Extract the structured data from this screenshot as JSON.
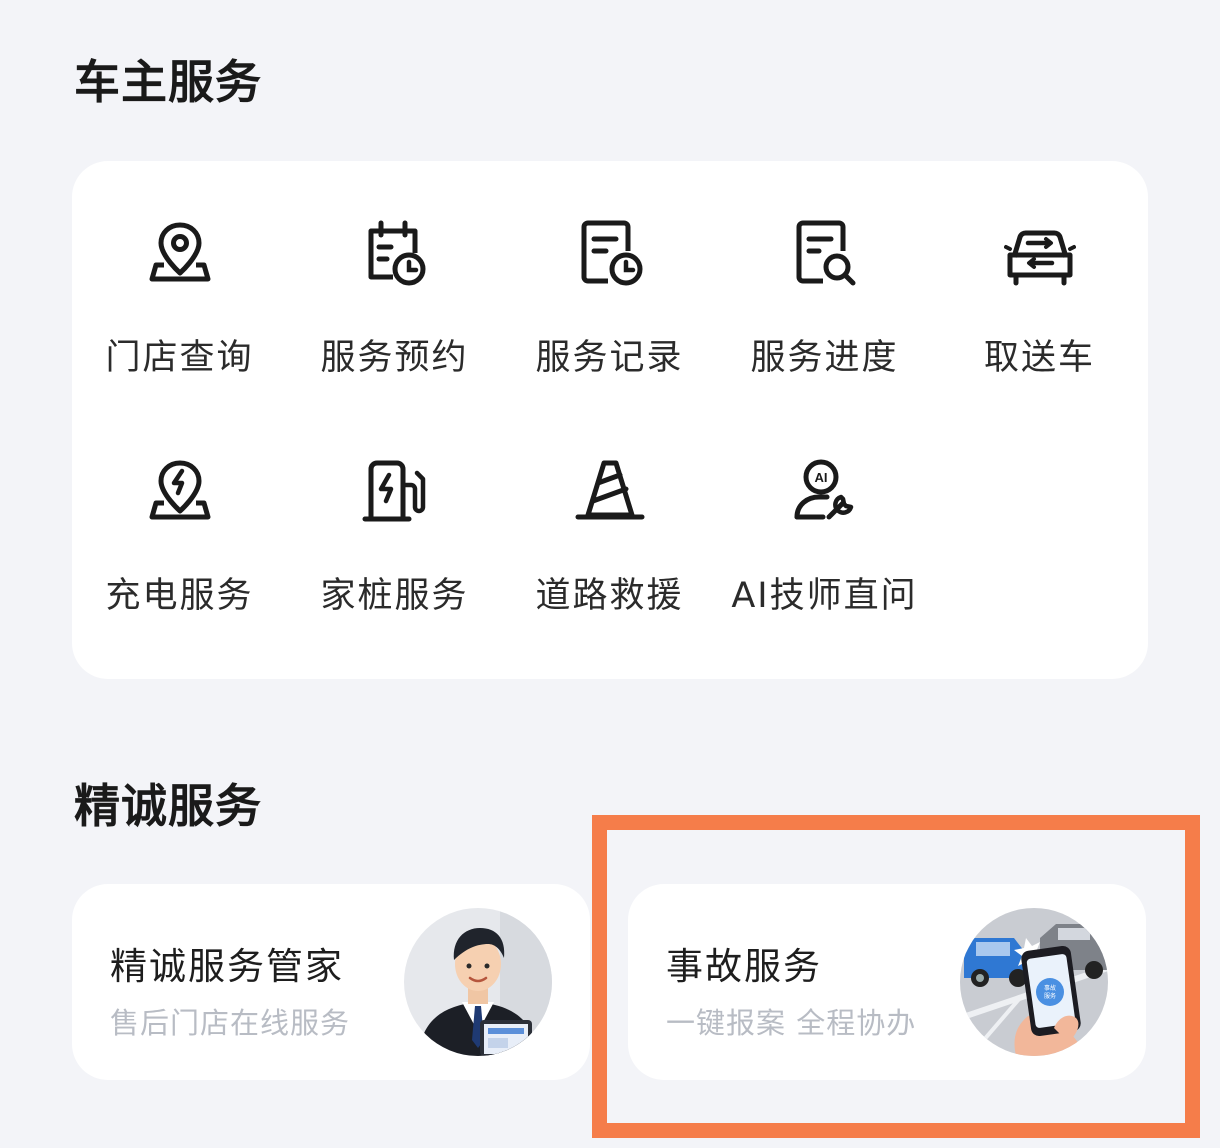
{
  "sections": {
    "owner_services_title": "车主服务",
    "premium_services_title": "精诚服务"
  },
  "grid": [
    {
      "label": "门店查询",
      "icon": "store-location-pin-icon"
    },
    {
      "label": "服务预约",
      "icon": "calendar-clock-icon"
    },
    {
      "label": "服务记录",
      "icon": "document-clock-icon"
    },
    {
      "label": "服务进度",
      "icon": "document-search-icon"
    },
    {
      "label": "取送车",
      "icon": "car-swap-icon"
    },
    {
      "label": "充电服务",
      "icon": "charging-location-pin-icon"
    },
    {
      "label": "家桩服务",
      "icon": "home-charger-icon"
    },
    {
      "label": "道路救援",
      "icon": "traffic-cone-icon"
    },
    {
      "label": "AI技师直问",
      "icon": "ai-technician-icon"
    }
  ],
  "cards": {
    "steward": {
      "title": "精诚服务管家",
      "subtitle": "售后门店在线服务",
      "image": "service-steward-avatar"
    },
    "accident": {
      "title": "事故服务",
      "subtitle": "一键报案 全程协办",
      "image": "car-accident-phone-illustration",
      "phone_screen_text": "事故服务"
    }
  },
  "colors": {
    "background": "#f3f4f8",
    "card": "#ffffff",
    "highlight": "#f57d4a",
    "subtitle": "#b8bcc4"
  }
}
